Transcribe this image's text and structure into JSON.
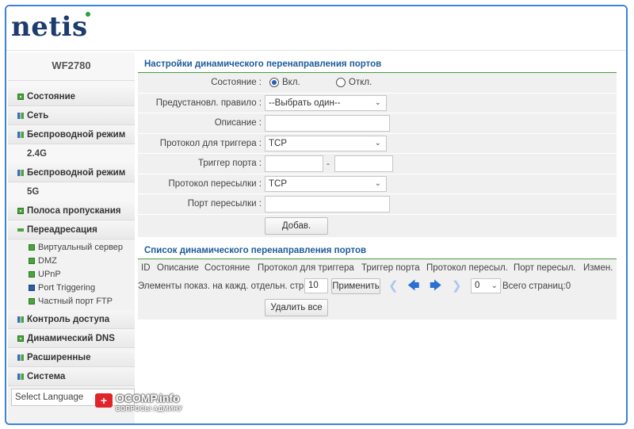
{
  "brand": {
    "logo_text": "netis"
  },
  "sidebar": {
    "model": "WF2780",
    "items": [
      {
        "label": "Состояние",
        "icon": "plus-square-icon"
      },
      {
        "label": "Сеть",
        "icon": "grid-icon"
      },
      {
        "label": "Беспроводной режим",
        "icon": "grid-icon"
      },
      {
        "label": "2.4G",
        "icon": ""
      },
      {
        "label": "Беспроводной режим",
        "icon": "grid-icon"
      },
      {
        "label": "5G",
        "icon": ""
      },
      {
        "label": "Полоса пропускания",
        "icon": "plus-square-icon"
      },
      {
        "label": "Переадресация",
        "icon": "minus-icon"
      }
    ],
    "sub_items": [
      {
        "label": "Виртуальный сервер"
      },
      {
        "label": "DMZ"
      },
      {
        "label": "UPnP"
      },
      {
        "label": "Port Triggering"
      },
      {
        "label": "Частный порт FTP"
      }
    ],
    "items_after": [
      {
        "label": "Контроль доступа"
      },
      {
        "label": "Динамический DNS"
      },
      {
        "label": "Расширенные"
      },
      {
        "label": "Система"
      }
    ],
    "language_select": "Select Language"
  },
  "form": {
    "title": "Настройки динамического перенаправления портов",
    "status_label": "Состояние :",
    "status_on": "Вкл.",
    "status_off": "Откл.",
    "status_selected": "on",
    "preset_label": "Предустановл. правило :",
    "preset_value": "--Выбрать один--",
    "description_label": "Описание :",
    "description_value": "",
    "trigger_protocol_label": "Протокол для триггера :",
    "trigger_protocol_value": "TCP",
    "trigger_port_label": "Триггер порта :",
    "trigger_port_from": "",
    "trigger_port_to": "",
    "port_separator": "-",
    "forward_protocol_label": "Протокол пересылки :",
    "forward_protocol_value": "TCP",
    "forward_port_label": "Порт пересылки :",
    "forward_port_value": "",
    "add_button": "Добав."
  },
  "list": {
    "title": "Список динамического перенаправления портов",
    "columns": [
      "ID",
      "Описание",
      "Состояние",
      "Протокол для триггера",
      "Триггер порта",
      "Протокол пересыл.",
      "Порт пересыл.",
      "Измен."
    ],
    "per_page_label": "Элементы показ. на кажд. отдельн. стр.",
    "per_page_value": "10",
    "apply_button": "Применить",
    "page_value": "0",
    "total_pages_label": "Всего страниц:0",
    "delete_all_button": "Удалить все"
  },
  "watermark": {
    "name": "OCOMP.info",
    "sub": "ВОПРОСЫ АДМИНУ",
    "badge": "+"
  },
  "colors": {
    "frame": "#3b82d9",
    "brand": "#1d3b6e",
    "accent_green": "#4aa33c",
    "section_title": "#1e5c9a",
    "arrow_blue": "#2a6fd1"
  }
}
